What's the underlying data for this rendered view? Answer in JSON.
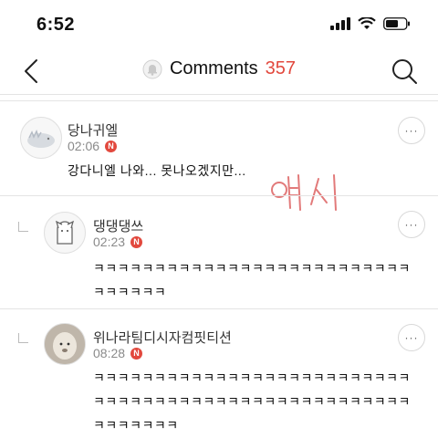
{
  "status_bar": {
    "time": "6:52"
  },
  "nav": {
    "back_icon": "chevron-left-icon",
    "bell_icon": "bell-icon",
    "title": "Comments",
    "count": "357",
    "search_icon": "search-icon",
    "accent_color": "#e2483d"
  },
  "comments": [
    {
      "author": "당나귀엘",
      "time": "02:06",
      "badge": "N",
      "text": "강다니엘 나와... 못나오겠지만...",
      "is_reply": false,
      "more_label": "···"
    },
    {
      "author": "댕댕댕쓰",
      "time": "02:23",
      "badge": "N",
      "text": "ㅋㅋㅋㅋㅋㅋㅋㅋㅋㅋㅋㅋㅋㅋㅋㅋㅋㅋㅋㅋㅋㅋㅋㅋㅋㅋㅋㅋㅋㅋㅋㅋ",
      "is_reply": true,
      "more_label": "···"
    },
    {
      "author": "위나라팀디시자컴핏티션",
      "time": "08:28",
      "badge": "N",
      "text": "ㅋㅋㅋㅋㅋㅋㅋㅋㅋㅋㅋㅋㅋㅋㅋㅋㅋㅋㅋㅋㅋㅋㅋㅋㅋㅋㅋㅋㅋㅋㅋㅋㅋㅋㅋㅋㅋㅋㅋㅋㅋㅋㅋㅋㅋㅋㅋㅋㅋㅋㅋㅋㅋㅋㅋㅋㅋㅋㅋ",
      "is_reply": true,
      "more_label": "···"
    }
  ],
  "handwriting": {
    "text": "여시",
    "color": "#e27a7a"
  }
}
